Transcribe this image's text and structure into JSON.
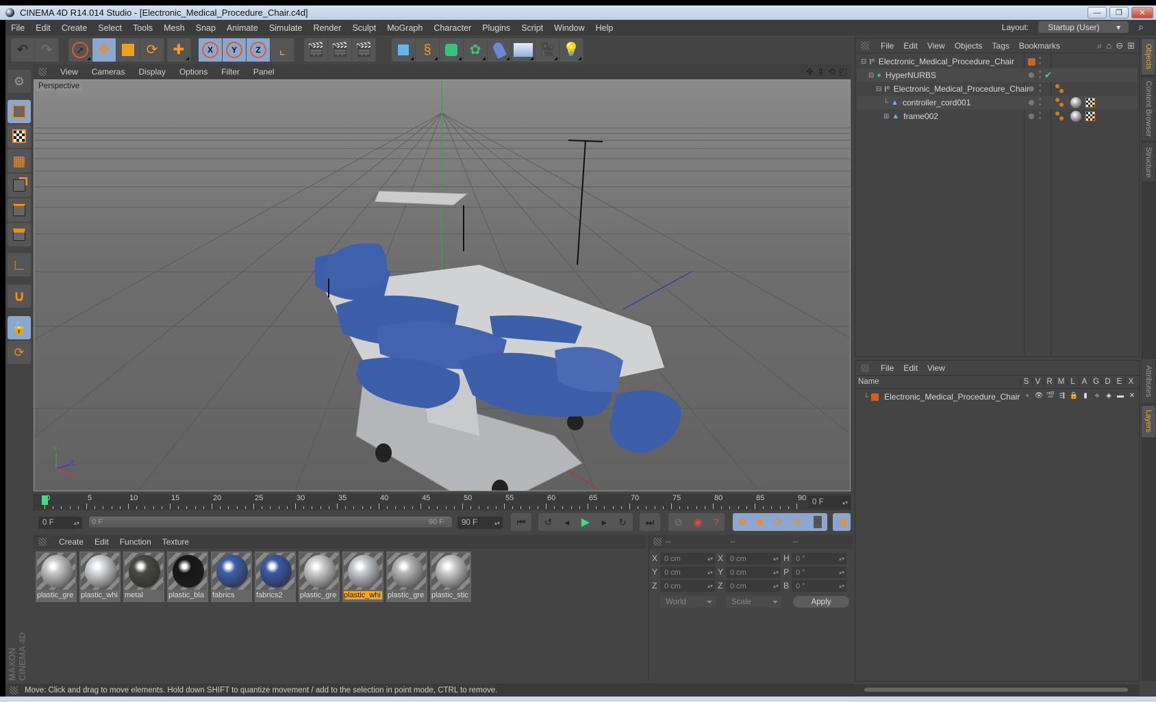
{
  "window": {
    "title": "CINEMA 4D R14.014 Studio - [Electronic_Medical_Procedure_Chair.c4d]",
    "controls": [
      "minimize",
      "restore",
      "close"
    ]
  },
  "menubar": {
    "items": [
      "File",
      "Edit",
      "Create",
      "Select",
      "Tools",
      "Mesh",
      "Snap",
      "Animate",
      "Simulate",
      "Render",
      "Sculpt",
      "MoGraph",
      "Character",
      "Plugins",
      "Script",
      "Window",
      "Help"
    ],
    "layout_label": "Layout:",
    "layout_value": "Startup (User)"
  },
  "toolbar": {
    "groups": [
      {
        "name": "history",
        "tools": [
          "undo-icon",
          "redo-icon"
        ]
      },
      {
        "name": "transform",
        "tools": [
          "live-selection-icon",
          "move-icon",
          "scale-icon",
          "rotate-icon"
        ]
      },
      {
        "name": "recent",
        "tools": [
          "recent-tool-icon"
        ]
      },
      {
        "name": "axis-lock",
        "tools": [
          "x-axis-icon",
          "y-axis-icon",
          "z-axis-icon",
          "coordinate-system-icon"
        ]
      },
      {
        "name": "render",
        "tools": [
          "render-view-icon",
          "render-picture-viewer-icon",
          "render-settings-icon"
        ]
      },
      {
        "name": "create",
        "tools": [
          "cube-icon",
          "spline-pen-icon",
          "subdivision-surface-icon",
          "array-icon",
          "deformer-bend-icon",
          "floor-icon",
          "camera-icon",
          "light-icon"
        ]
      }
    ]
  },
  "left_tools": [
    "make-editable-icon",
    "model-mode-icon",
    "texture-mode-icon",
    "workplane-mode-icon",
    "points-mode-icon",
    "edges-mode-icon",
    "polygons-mode-icon",
    "axis-mode-icon",
    "magnet-icon",
    "locked-workplane-icon",
    "planar-workplane-icon"
  ],
  "viewport": {
    "menu": [
      "View",
      "Cameras",
      "Display",
      "Options",
      "Filter",
      "Panel"
    ],
    "label": "Perspective",
    "nav_icons": [
      "pan-icon",
      "dolly-icon",
      "rotate-view-icon",
      "maximize-view-icon"
    ],
    "axis_labels": {
      "x": "X",
      "y": "Y",
      "z": "Z"
    }
  },
  "timeline": {
    "ticks": [
      "0",
      "5",
      "10",
      "15",
      "20",
      "25",
      "30",
      "35",
      "40",
      "45",
      "50",
      "55",
      "60",
      "65",
      "70",
      "75",
      "80",
      "85",
      "90"
    ],
    "current_frame": "0 F",
    "start_field": "0 F",
    "range_start": "0 F",
    "range_end": "90 F",
    "end_field": "90 F",
    "playhead_frame": 0,
    "range_max_frame": 90
  },
  "transport": {
    "buttons": [
      "go-to-start-icon",
      "previous-keyframe-icon",
      "previous-frame-icon",
      "play-icon",
      "next-frame-icon",
      "next-keyframe-icon",
      "go-to-end-icon"
    ],
    "record": [
      "autokey-disabled-icon",
      "record-active-objects-icon",
      "keyframe-selection-icon"
    ],
    "key_params": [
      "key-position-icon",
      "key-scale-icon",
      "key-rotation-icon",
      "key-parameter-icon",
      "key-point-level-icon"
    ],
    "timeline_icon": "timeline-icon"
  },
  "materials": {
    "menu": [
      "Create",
      "Edit",
      "Function",
      "Texture"
    ],
    "items": [
      {
        "label": "plastic_gre",
        "color": "#c9c9c9",
        "selected": false
      },
      {
        "label": "plastic_whi",
        "color": "#d6d9de",
        "selected": false
      },
      {
        "label": "metal",
        "color": "#4a4a42",
        "selected": false
      },
      {
        "label": "plastic_bla",
        "color": "#151515",
        "selected": false
      },
      {
        "label": "fabrics",
        "color": "#3e5fa6",
        "selected": false
      },
      {
        "label": "fabrics2",
        "color": "#3a5aa4",
        "selected": false
      },
      {
        "label": "plastic_gre",
        "color": "#d0d0d0",
        "selected": false
      },
      {
        "label": "plastic_whi",
        "color": "#c8ccd2",
        "selected": true
      },
      {
        "label": "plastic_gre",
        "color": "#b8b8b8",
        "selected": false
      },
      {
        "label": "plastic_stic",
        "color": "#cfcfcf",
        "selected": false
      }
    ]
  },
  "coordinates": {
    "headers": [
      "--",
      "--",
      "--"
    ],
    "rows": [
      {
        "l1": "X",
        "v1": "0 cm",
        "l2": "X",
        "v2": "0 cm",
        "l3": "H",
        "v3": "0 °"
      },
      {
        "l1": "Y",
        "v1": "0 cm",
        "l2": "Y",
        "v2": "0 cm",
        "l3": "P",
        "v3": "0 °"
      },
      {
        "l1": "Z",
        "v1": "0 cm",
        "l2": "Z",
        "v2": "0 cm",
        "l3": "B",
        "v3": "0 °"
      }
    ],
    "mode_select": "World",
    "scale_select": "Scale",
    "apply_label": "Apply"
  },
  "objects": {
    "menu": [
      "File",
      "Edit",
      "View",
      "Objects",
      "Tags",
      "Bookmarks"
    ],
    "header_icons": [
      "search-icon",
      "home-icon",
      "view-icon",
      "new-panel-icon"
    ],
    "rows": [
      {
        "name": "Electronic_Medical_Procedure_Chair",
        "depth": 0,
        "icon": "null-icon",
        "expander": "minus",
        "layer_color": "#d45f1c",
        "check": false,
        "tags": []
      },
      {
        "name": "HyperNURBS",
        "depth": 1,
        "icon": "hypernurbs-icon",
        "expander": "minus",
        "layer_color": "",
        "check": true,
        "tags": []
      },
      {
        "name": "Electronic_Medical_Procedure_Chair",
        "depth": 2,
        "icon": "null-icon",
        "expander": "minus",
        "layer_color": "",
        "check": false,
        "tags": [
          "phong-tag"
        ]
      },
      {
        "name": "controller_cord001",
        "depth": 3,
        "icon": "polygon-object-icon",
        "expander": "",
        "layer_color": "",
        "check": false,
        "tags": [
          "phong-tag",
          "material-tag",
          "uvw-tag"
        ]
      },
      {
        "name": "frame002",
        "depth": 3,
        "icon": "polygon-object-icon",
        "expander": "plus",
        "layer_color": "",
        "check": false,
        "tags": [
          "phong-tag",
          "material-tag",
          "uvw-tag"
        ]
      }
    ]
  },
  "layers": {
    "menu": [
      "File",
      "Edit",
      "View"
    ],
    "columns": [
      "Name",
      "S",
      "V",
      "R",
      "M",
      "L",
      "A",
      "G",
      "D",
      "E",
      "X"
    ],
    "rows": [
      {
        "name": "Electronic_Medical_Procedure_Chair",
        "color": "#d45f1c"
      }
    ]
  },
  "right_tabs": [
    {
      "label": "Objects",
      "active": true
    },
    {
      "label": "Content Browser",
      "active": false
    },
    {
      "label": "Structure",
      "active": false
    },
    {
      "label": "Attributes",
      "active": false
    },
    {
      "label": "Layers",
      "active": true
    }
  ],
  "status": "Move: Click and drag to move elements. Hold down SHIFT to quantize movement / add to the selection in point mode, CTRL to remove.",
  "branding": "MAXON CINEMA 4D",
  "colors": {
    "accent": "#f5a623",
    "selected_tool": "#8ba7cf",
    "panel_bg": "#444444",
    "play_green": "#3ddc84"
  }
}
